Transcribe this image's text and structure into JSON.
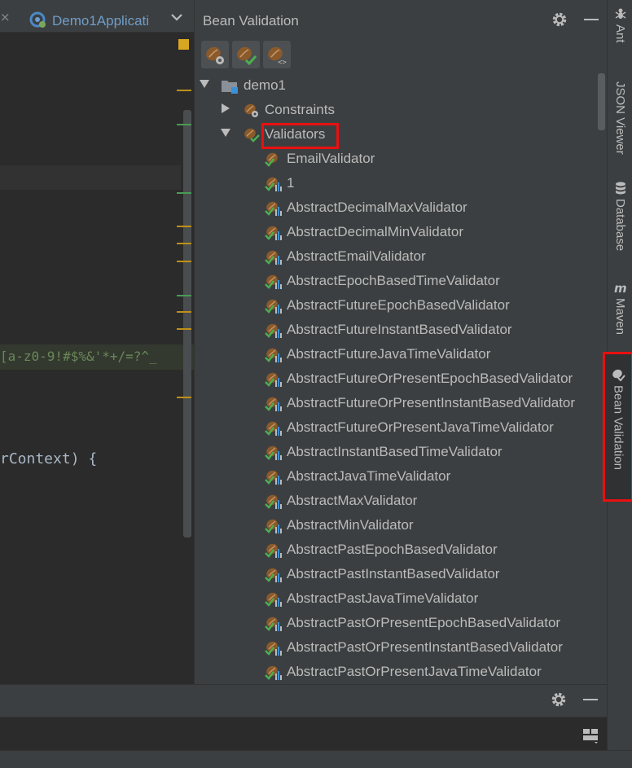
{
  "editor": {
    "tab_close_glyph": "×",
    "tab_label": "Demo1Applicati",
    "tab_icon": "spring-boot-app-icon",
    "regex_snippet": "[a-z0-9!#$%&'*+/=?^_",
    "code_snippet": "rContext) {"
  },
  "panel": {
    "title": "Bean Validation",
    "toolbar": [
      "constraints-toolbar-icon",
      "validators-toolbar-icon",
      "code-toolbar-icon"
    ],
    "tree": {
      "root": "demo1",
      "constraints": "Constraints",
      "validators": "Validators",
      "validator_items": [
        "EmailValidator",
        "1",
        "AbstractDecimalMaxValidator",
        "AbstractDecimalMinValidator",
        "AbstractEmailValidator",
        "AbstractEpochBasedTimeValidator",
        "AbstractFutureEpochBasedValidator",
        "AbstractFutureInstantBasedValidator",
        "AbstractFutureJavaTimeValidator",
        "AbstractFutureOrPresentEpochBasedValidator",
        "AbstractFutureOrPresentInstantBasedValidator",
        "AbstractFutureOrPresentJavaTimeValidator",
        "AbstractInstantBasedTimeValidator",
        "AbstractJavaTimeValidator",
        "AbstractMaxValidator",
        "AbstractMinValidator",
        "AbstractPastEpochBasedValidator",
        "AbstractPastInstantBasedValidator",
        "AbstractPastJavaTimeValidator",
        "AbstractPastOrPresentEpochBasedValidator",
        "AbstractPastOrPresentInstantBasedValidator",
        "AbstractPastOrPresentJavaTimeValidator"
      ]
    }
  },
  "right_strip": {
    "tabs": [
      "Ant",
      "JSON Viewer",
      "Database",
      "Maven",
      "Bean Validation"
    ]
  },
  "colors": {
    "background": "#2b2b2b",
    "panel": "#3c3f41",
    "text": "#bbbbbb",
    "highlight": "#e81010",
    "check": "#4caf50",
    "bean": "#8b5a2b"
  }
}
